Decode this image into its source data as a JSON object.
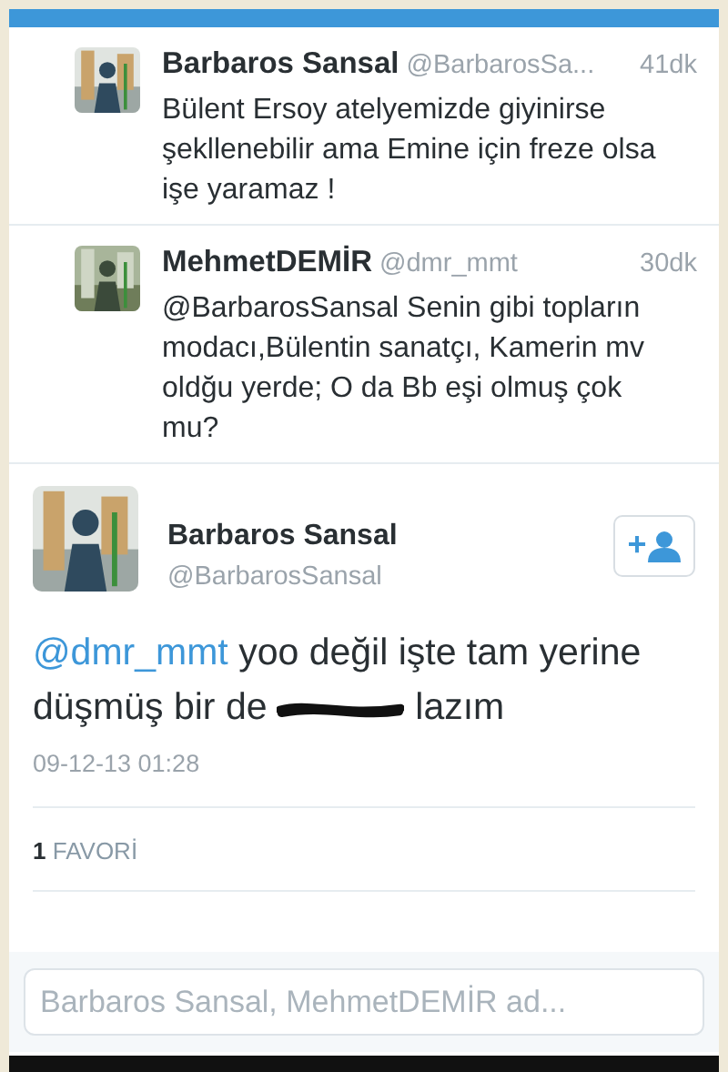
{
  "replies": [
    {
      "name": "Barbaros Sansal",
      "handle": "@BarbarosSa...",
      "time": "41dk",
      "text": "Bülent Ersoy atelyemizde giyinirse şekllenebilir ama Emine için freze olsa işe yaramaz !"
    },
    {
      "name": "MehmetDEMİR",
      "handle": "@dmr_mmt",
      "time": "30dk",
      "text": "@BarbarosSansal Senin gibi topların modacı,Bülentin sanatçı, Kamerin mv oldğu yerde; O da Bb eşi olmuş çok mu?"
    }
  ],
  "tweet": {
    "name": "Barbaros Sansal",
    "handle": "@BarbarosSansal",
    "follow_button": "+",
    "mention": "@dmr_mmt",
    "text_before": "yoo değil işte tam yerine düşmüş bir de",
    "redacted": true,
    "text_after": "lazım",
    "timestamp": "09-12-13 01:28",
    "favorites_count": "1",
    "favorites_label": "FAVORİ"
  },
  "reply_box": {
    "placeholder": "Barbaros Sansal, MehmetDEMİR ad..."
  }
}
